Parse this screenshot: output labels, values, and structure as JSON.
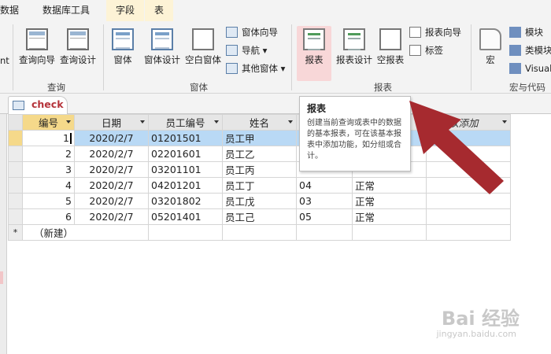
{
  "ribbon_tabs": [
    {
      "label": "数据"
    },
    {
      "label": "数据库工具"
    },
    {
      "label": "字段"
    },
    {
      "label": "表"
    }
  ],
  "ribbon": {
    "cut_text": "nt",
    "query": {
      "wizard": "查询向导",
      "design": "查询设计",
      "group": "查询"
    },
    "forms": {
      "form": "窗体",
      "form_design": "窗体设计",
      "blank_form": "空白窗体",
      "form_wizard": "窗体向导",
      "navigation": "导航",
      "more_forms": "其他窗体",
      "group": "窗体"
    },
    "reports": {
      "report": "报表",
      "report_design": "报表设计",
      "blank_report": "空报表",
      "report_wizard": "报表向导",
      "labels": "标签",
      "group": "报表"
    },
    "macros": {
      "macro": "宏",
      "module": "模块",
      "class_module": "类模块",
      "visual_basic": "Visual",
      "group": "宏与代码"
    }
  },
  "doc_tab": {
    "name": "check"
  },
  "tooltip": {
    "title": "报表",
    "description": "创建当前查询或表中的数据的基本报表，可在该基本报表中添加功能，如分组或合计。"
  },
  "table": {
    "columns": [
      "编号",
      "日期",
      "员工编号",
      "姓名",
      "",
      "",
      "单击以添加"
    ],
    "rows": [
      {
        "id": "1",
        "date": "2020/2/7",
        "emp_no": "01201501",
        "name": "员工甲",
        "dept": "",
        "status": ""
      },
      {
        "id": "2",
        "date": "2020/2/7",
        "emp_no": "02201601",
        "name": "员工乙",
        "dept": "",
        "status": ""
      },
      {
        "id": "3",
        "date": "2020/2/7",
        "emp_no": "03201101",
        "name": "员工丙",
        "dept": "",
        "status": ""
      },
      {
        "id": "4",
        "date": "2020/2/7",
        "emp_no": "04201201",
        "name": "员工丁",
        "dept": "04",
        "status": "正常"
      },
      {
        "id": "5",
        "date": "2020/2/7",
        "emp_no": "03201802",
        "name": "员工戊",
        "dept": "03",
        "status": "正常"
      },
      {
        "id": "6",
        "date": "2020/2/7",
        "emp_no": "05201401",
        "name": "员工己",
        "dept": "05",
        "status": "正常"
      }
    ],
    "new_row_marker": "*",
    "new_row_label": "（新建）"
  },
  "watermark": {
    "brand": "Bai 经验",
    "url": "jingyan.baidu.com"
  },
  "colors": {
    "accent": "#b5333a",
    "arrow": "#a62a2f",
    "selected_header": "#f5d98a",
    "current_row": "#b9d9f5"
  }
}
